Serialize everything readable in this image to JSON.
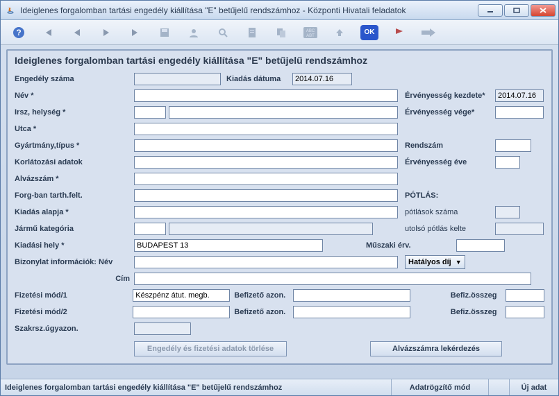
{
  "window": {
    "title": "Ideiglenes forgalomban tartási engedély kiállítása \"E\" betűjelű rendszámhoz - Központi Hivatali feladatok"
  },
  "panel": {
    "title": "Ideiglenes forgalomban tartási engedély kiállítása \"E\" betűjelű rendszámhoz"
  },
  "labels": {
    "engedely_szama": "Engedély száma",
    "kiadas_datuma": "Kiadás dátuma",
    "nev": "Név *",
    "erv_kezdete": "Érvényesség kezdete*",
    "irsz_helyseg": "Irsz, helység *",
    "erv_vege": "Érvényesség vége*",
    "utca": "Utca *",
    "gyartmany": "Gyártmány,típus *",
    "rendszam": "Rendszám",
    "korlatozasi": "Korlátozási adatok",
    "erv_eve": "Érvényesség éve",
    "alvazszam": "Alvázszám *",
    "forg_ban": "Forg-ban tarth.felt.",
    "potlas": "PÓTLÁS:",
    "kiadas_alapja": "Kiadás alapja *",
    "potlasok_szama": "pótlások száma",
    "jarmu_kat": "Jármű kategória",
    "utolso_potlas": "utolsó pótlás kelte",
    "kiadasi_hely": "Kiadási hely *",
    "muszaki_erv": "Műszaki érv.",
    "bizonylat": "Bizonylat információk: Név",
    "cim": "Cím",
    "fiz_mod1": "Fizetési mód/1",
    "fiz_mod2": "Fizetési mód/2",
    "befizeto_azon": "Befizető azon.",
    "befiz_osszeg": "Befiz.összeg",
    "szakrsz": "Szakrsz.úgyazon."
  },
  "values": {
    "kiadas_datuma": "2014.07.16",
    "erv_kezdete": "2014.07.16",
    "kiadasi_hely": "BUDAPEST 13",
    "fiz_mod1": "Készpénz átut. megb.",
    "dropdown": "Hatályos díj"
  },
  "buttons": {
    "torles": "Engedély és fizetési adatok törlése",
    "alvazszam_lekerdezes": "Alvázszámra lekérdezés"
  },
  "status": {
    "left": "Ideiglenes forgalomban tartási engedély kiállítása \"E\" betűjelű rendszámhoz",
    "mode": "Adatrögzítő mód",
    "right": "Új adat"
  }
}
